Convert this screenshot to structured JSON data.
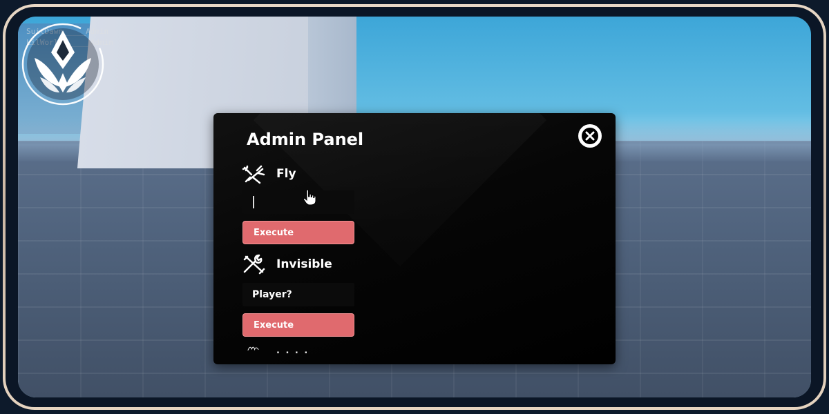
{
  "game": {
    "player_list": [
      "SuitDawn_____Admin",
      "LilWorld______Admin"
    ]
  },
  "panel": {
    "title": "Admin Panel",
    "commands": [
      {
        "label": "Fly",
        "icon": "wrench-plane-icon",
        "input_value": "",
        "input_placeholder": "",
        "button_label": "Execute"
      },
      {
        "label": "Invisible",
        "icon": "wrench-tools-icon",
        "input_value": "",
        "input_placeholder": "Player?",
        "button_label": "Execute"
      },
      {
        "label": ". . . .",
        "icon": "wave-icon"
      }
    ]
  },
  "colors": {
    "accent": "#e06a6e",
    "panel_bg": "#050505",
    "frame": "#d9c6b2"
  }
}
